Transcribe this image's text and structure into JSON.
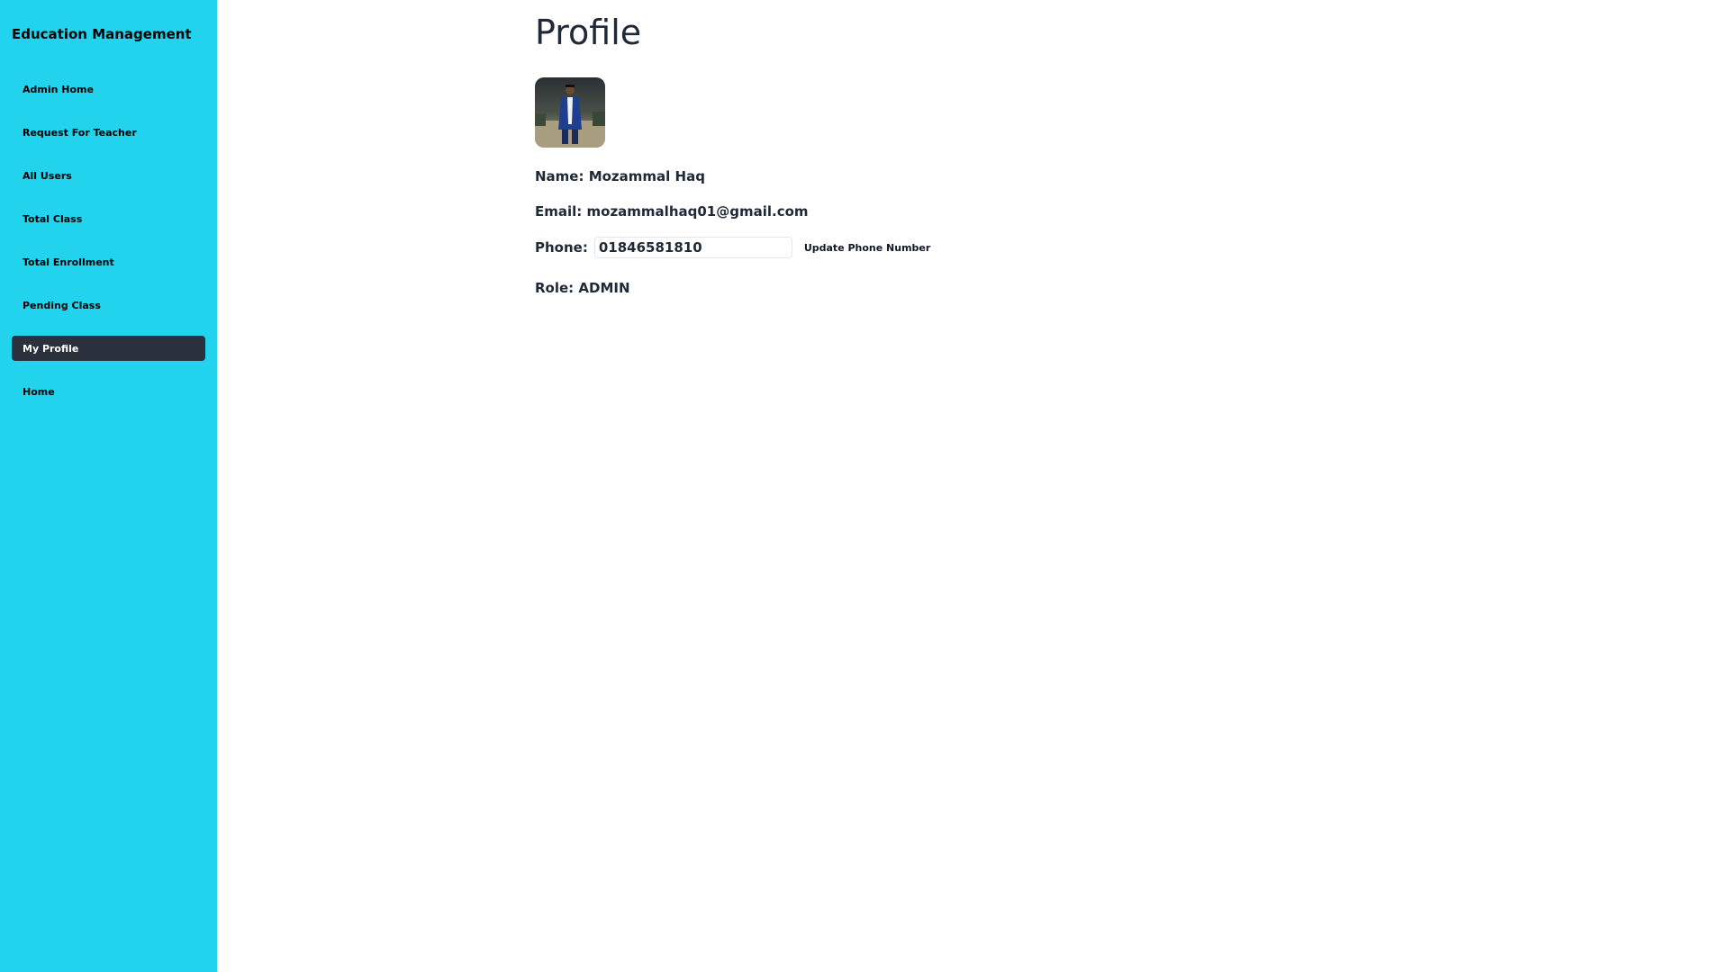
{
  "sidebar": {
    "brand": "Education Management",
    "background_color": "#22d3ee",
    "active_color": "#2a303c",
    "items": [
      {
        "label": "Admin Home"
      },
      {
        "label": "Request For Teacher"
      },
      {
        "label": "All Users"
      },
      {
        "label": "Total Class"
      },
      {
        "label": "Total Enrollment"
      },
      {
        "label": "Pending Class"
      },
      {
        "label": "My Profile",
        "active": true
      },
      {
        "label": "Home"
      }
    ]
  },
  "profile": {
    "title": "Profile",
    "avatar_icon": "user-photo",
    "name_text": "Name: Mozammal Haq",
    "email_text": "Email: mozammalhaq01@gmail.com",
    "phone_label": "Phone:",
    "phone_value": "01846581810",
    "update_button_label": "Update Phone Number",
    "role_text": "Role: ADMIN"
  }
}
